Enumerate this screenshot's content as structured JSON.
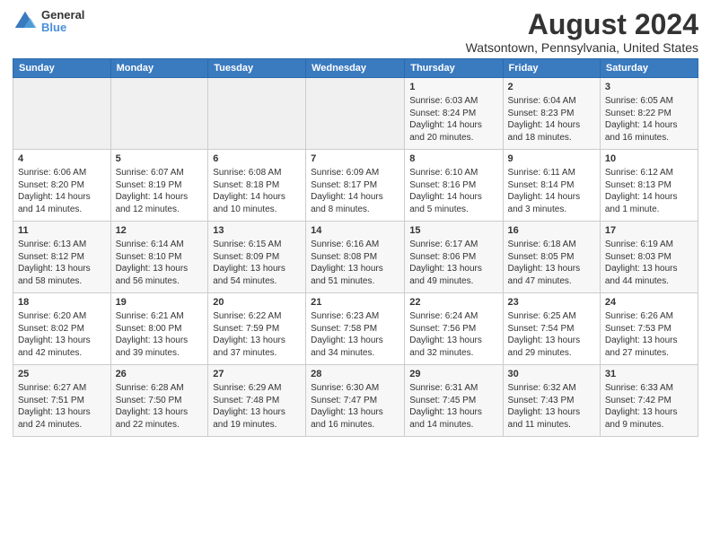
{
  "header": {
    "logo_line1": "General",
    "logo_line2": "Blue",
    "title": "August 2024",
    "subtitle": "Watsontown, Pennsylvania, United States"
  },
  "days_of_week": [
    "Sunday",
    "Monday",
    "Tuesday",
    "Wednesday",
    "Thursday",
    "Friday",
    "Saturday"
  ],
  "weeks": [
    [
      {
        "day": "",
        "content": ""
      },
      {
        "day": "",
        "content": ""
      },
      {
        "day": "",
        "content": ""
      },
      {
        "day": "",
        "content": ""
      },
      {
        "day": "1",
        "content": "Sunrise: 6:03 AM\nSunset: 8:24 PM\nDaylight: 14 hours\nand 20 minutes."
      },
      {
        "day": "2",
        "content": "Sunrise: 6:04 AM\nSunset: 8:23 PM\nDaylight: 14 hours\nand 18 minutes."
      },
      {
        "day": "3",
        "content": "Sunrise: 6:05 AM\nSunset: 8:22 PM\nDaylight: 14 hours\nand 16 minutes."
      }
    ],
    [
      {
        "day": "4",
        "content": "Sunrise: 6:06 AM\nSunset: 8:20 PM\nDaylight: 14 hours\nand 14 minutes."
      },
      {
        "day": "5",
        "content": "Sunrise: 6:07 AM\nSunset: 8:19 PM\nDaylight: 14 hours\nand 12 minutes."
      },
      {
        "day": "6",
        "content": "Sunrise: 6:08 AM\nSunset: 8:18 PM\nDaylight: 14 hours\nand 10 minutes."
      },
      {
        "day": "7",
        "content": "Sunrise: 6:09 AM\nSunset: 8:17 PM\nDaylight: 14 hours\nand 8 minutes."
      },
      {
        "day": "8",
        "content": "Sunrise: 6:10 AM\nSunset: 8:16 PM\nDaylight: 14 hours\nand 5 minutes."
      },
      {
        "day": "9",
        "content": "Sunrise: 6:11 AM\nSunset: 8:14 PM\nDaylight: 14 hours\nand 3 minutes."
      },
      {
        "day": "10",
        "content": "Sunrise: 6:12 AM\nSunset: 8:13 PM\nDaylight: 14 hours\nand 1 minute."
      }
    ],
    [
      {
        "day": "11",
        "content": "Sunrise: 6:13 AM\nSunset: 8:12 PM\nDaylight: 13 hours\nand 58 minutes."
      },
      {
        "day": "12",
        "content": "Sunrise: 6:14 AM\nSunset: 8:10 PM\nDaylight: 13 hours\nand 56 minutes."
      },
      {
        "day": "13",
        "content": "Sunrise: 6:15 AM\nSunset: 8:09 PM\nDaylight: 13 hours\nand 54 minutes."
      },
      {
        "day": "14",
        "content": "Sunrise: 6:16 AM\nSunset: 8:08 PM\nDaylight: 13 hours\nand 51 minutes."
      },
      {
        "day": "15",
        "content": "Sunrise: 6:17 AM\nSunset: 8:06 PM\nDaylight: 13 hours\nand 49 minutes."
      },
      {
        "day": "16",
        "content": "Sunrise: 6:18 AM\nSunset: 8:05 PM\nDaylight: 13 hours\nand 47 minutes."
      },
      {
        "day": "17",
        "content": "Sunrise: 6:19 AM\nSunset: 8:03 PM\nDaylight: 13 hours\nand 44 minutes."
      }
    ],
    [
      {
        "day": "18",
        "content": "Sunrise: 6:20 AM\nSunset: 8:02 PM\nDaylight: 13 hours\nand 42 minutes."
      },
      {
        "day": "19",
        "content": "Sunrise: 6:21 AM\nSunset: 8:00 PM\nDaylight: 13 hours\nand 39 minutes."
      },
      {
        "day": "20",
        "content": "Sunrise: 6:22 AM\nSunset: 7:59 PM\nDaylight: 13 hours\nand 37 minutes."
      },
      {
        "day": "21",
        "content": "Sunrise: 6:23 AM\nSunset: 7:58 PM\nDaylight: 13 hours\nand 34 minutes."
      },
      {
        "day": "22",
        "content": "Sunrise: 6:24 AM\nSunset: 7:56 PM\nDaylight: 13 hours\nand 32 minutes."
      },
      {
        "day": "23",
        "content": "Sunrise: 6:25 AM\nSunset: 7:54 PM\nDaylight: 13 hours\nand 29 minutes."
      },
      {
        "day": "24",
        "content": "Sunrise: 6:26 AM\nSunset: 7:53 PM\nDaylight: 13 hours\nand 27 minutes."
      }
    ],
    [
      {
        "day": "25",
        "content": "Sunrise: 6:27 AM\nSunset: 7:51 PM\nDaylight: 13 hours\nand 24 minutes."
      },
      {
        "day": "26",
        "content": "Sunrise: 6:28 AM\nSunset: 7:50 PM\nDaylight: 13 hours\nand 22 minutes."
      },
      {
        "day": "27",
        "content": "Sunrise: 6:29 AM\nSunset: 7:48 PM\nDaylight: 13 hours\nand 19 minutes."
      },
      {
        "day": "28",
        "content": "Sunrise: 6:30 AM\nSunset: 7:47 PM\nDaylight: 13 hours\nand 16 minutes."
      },
      {
        "day": "29",
        "content": "Sunrise: 6:31 AM\nSunset: 7:45 PM\nDaylight: 13 hours\nand 14 minutes."
      },
      {
        "day": "30",
        "content": "Sunrise: 6:32 AM\nSunset: 7:43 PM\nDaylight: 13 hours\nand 11 minutes."
      },
      {
        "day": "31",
        "content": "Sunrise: 6:33 AM\nSunset: 7:42 PM\nDaylight: 13 hours\nand 9 minutes."
      }
    ]
  ]
}
